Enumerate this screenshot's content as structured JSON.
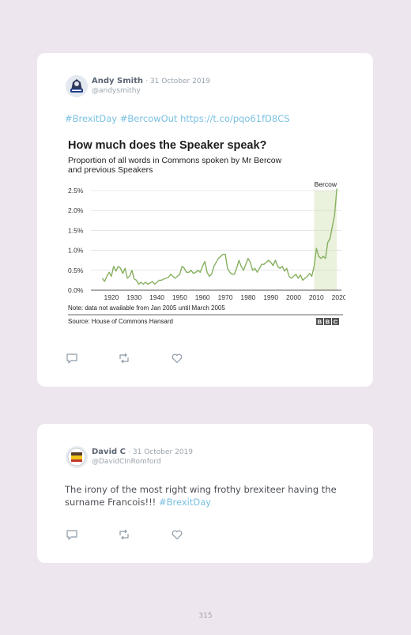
{
  "tweets": [
    {
      "name": "Andy Smith",
      "date": "31 October 2019",
      "handle": "@andysmithy",
      "text": "",
      "hashtags": [
        "#BrexitDay",
        "#BercowOut"
      ],
      "url": "https://t.co/pqo61fD8CS"
    },
    {
      "name": "David C",
      "date": "31 October 2019",
      "handle": "@DavidCInRomford",
      "text": "The irony of the most right wing frothy brexiteer having the surname Francois!!!",
      "hashtags": [
        "#BrexitDay"
      ]
    }
  ],
  "icons": [
    "reply-icon",
    "retweet-icon",
    "like-icon"
  ],
  "chart": {
    "note": "Note: data not available from Jan 2005 until March 2005",
    "source": "Source: House of Commons Hansard",
    "logo": "BBC"
  },
  "chart_data": {
    "type": "line",
    "title": "How much does the Speaker speak?",
    "subtitle": "Proportion of all words in Commons spoken by Mr Bercow and previous Speakers",
    "xlabel": "",
    "ylabel": "",
    "xlim": [
      1911,
      2021
    ],
    "ylim": [
      0,
      2.5
    ],
    "yticks": [
      "0.0%",
      "0.5%",
      "1.0%",
      "1.5%",
      "2.0%",
      "2.5%"
    ],
    "xticks": [
      "1920",
      "1930",
      "1940",
      "1950",
      "1960",
      "1970",
      "1980",
      "1990",
      "2000",
      "2010",
      "2020"
    ],
    "grid": true,
    "color": "#86b05f",
    "highlight": {
      "label": "Bercow",
      "from": 2009,
      "to": 2019,
      "color": "#eaf1dc"
    },
    "series": [
      {
        "name": "",
        "x": [
          1916,
          1917,
          1918,
          1919,
          1920,
          1921,
          1922,
          1923,
          1924,
          1925,
          1926,
          1927,
          1928,
          1929,
          1930,
          1931,
          1932,
          1933,
          1934,
          1935,
          1936,
          1937,
          1938,
          1939,
          1940,
          1941,
          1942,
          1943,
          1944,
          1945,
          1946,
          1947,
          1948,
          1949,
          1950,
          1951,
          1952,
          1953,
          1954,
          1955,
          1956,
          1957,
          1958,
          1959,
          1960,
          1961,
          1962,
          1963,
          1964,
          1965,
          1966,
          1967,
          1968,
          1969,
          1970,
          1971,
          1972,
          1973,
          1974,
          1975,
          1976,
          1977,
          1978,
          1979,
          1980,
          1981,
          1982,
          1983,
          1984,
          1985,
          1986,
          1987,
          1988,
          1989,
          1990,
          1991,
          1992,
          1993,
          1994,
          1995,
          1996,
          1997,
          1998,
          1999,
          2000,
          2001,
          2002,
          2003,
          2004,
          2005,
          2006,
          2007,
          2008,
          2009,
          2010,
          2011,
          2012,
          2013,
          2014,
          2015,
          2016,
          2017,
          2018,
          2019
        ],
        "y": [
          0.3,
          0.22,
          0.35,
          0.45,
          0.35,
          0.6,
          0.48,
          0.6,
          0.55,
          0.42,
          0.55,
          0.3,
          0.35,
          0.5,
          0.28,
          0.25,
          0.15,
          0.2,
          0.15,
          0.2,
          0.15,
          0.18,
          0.22,
          0.15,
          0.2,
          0.25,
          0.25,
          0.28,
          0.3,
          0.32,
          0.4,
          0.35,
          0.3,
          0.35,
          0.4,
          0.6,
          0.55,
          0.45,
          0.45,
          0.5,
          0.42,
          0.45,
          0.5,
          0.45,
          0.6,
          0.72,
          0.45,
          0.35,
          0.4,
          0.6,
          0.7,
          0.8,
          0.85,
          0.9,
          0.9,
          0.55,
          0.45,
          0.4,
          0.4,
          0.55,
          0.75,
          0.6,
          0.5,
          0.65,
          0.8,
          0.7,
          0.5,
          0.55,
          0.45,
          0.55,
          0.65,
          0.65,
          0.7,
          0.75,
          0.7,
          0.62,
          0.75,
          0.6,
          0.55,
          0.6,
          0.48,
          0.55,
          0.35,
          0.3,
          0.35,
          0.4,
          0.3,
          0.38,
          0.25,
          0.3,
          0.35,
          0.42,
          0.35,
          0.6,
          1.05,
          0.85,
          0.8,
          0.85,
          0.8,
          1.2,
          1.3,
          1.6,
          1.9,
          2.55
        ]
      }
    ]
  },
  "page": {
    "number": "315"
  }
}
